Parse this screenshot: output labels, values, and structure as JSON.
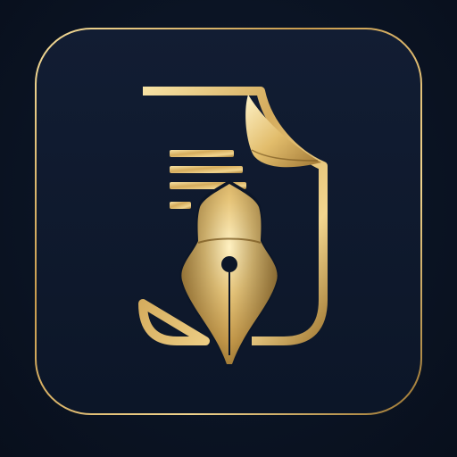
{
  "icon": {
    "name": "document-fountain-pen-app-icon",
    "colors": {
      "background": "#0b1424",
      "tile": "#0f1a2e",
      "gold_light": "#f3dc9a",
      "gold_mid": "#d2aa5a",
      "gold_dark": "#8a6a2c"
    }
  }
}
